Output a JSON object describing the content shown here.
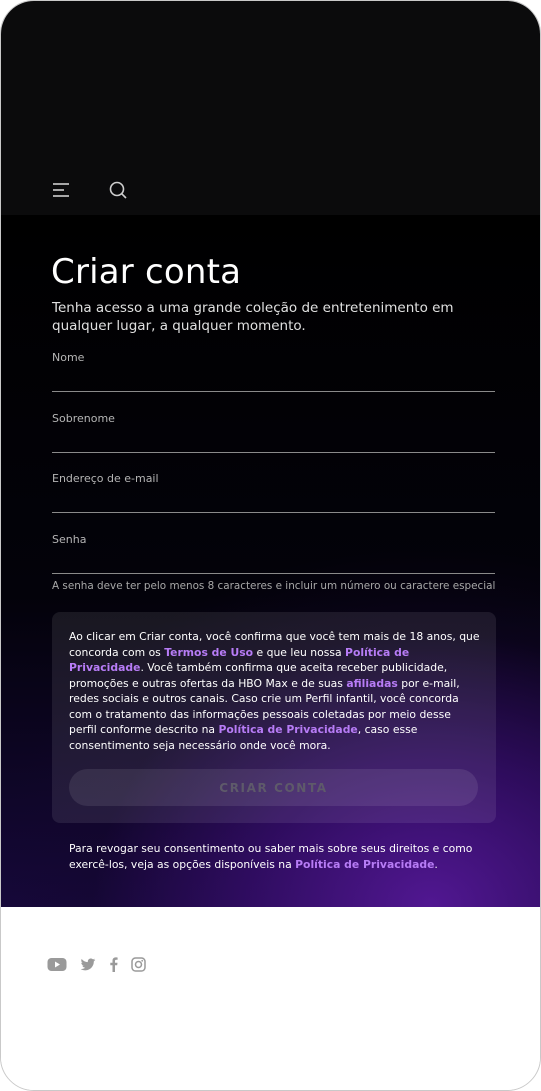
{
  "header": {
    "menu_icon": "hamburger-menu-icon",
    "search_icon": "search-icon"
  },
  "page": {
    "title": "Criar conta",
    "subtitle": "Tenha acesso a uma grande coleção de entretenimento em qualquer lugar, a qualquer momento."
  },
  "form": {
    "first_name_label": "Nome",
    "first_name_value": "",
    "last_name_label": "Sobrenome",
    "last_name_value": "",
    "email_label": "Endereço de e-mail",
    "email_value": "",
    "password_label": "Senha",
    "password_value": "",
    "password_hint": "A senha deve ter pelo menos 8 caracteres e incluir um número ou caractere especial"
  },
  "consent": {
    "text_1": "Ao clicar em Criar conta, você confirma que você tem mais de 18 anos, que concorda com os ",
    "terms_link": "Termos de Uso",
    "text_2": " e que leu nossa ",
    "privacy_link": "Política de Privacidade",
    "text_3": ". Você também confirma que aceita receber publicidade, promoções e outras ofertas da HBO Max e de suas ",
    "affiliates_link": "afiliadas",
    "text_4": " por e-mail, redes sociais e outros canais. Caso crie um Perfil infantil, você concorda com o tratamento das informações pessoais coletadas por meio desse perfil conforme descrito na ",
    "privacy_link_2": "Política de Privacidade",
    "text_5": ", caso esse consentimento seja necessário onde você mora.",
    "button_label": "CRIAR CONTA",
    "button_enabled": false
  },
  "revoke": {
    "text": "Para revogar seu consentimento ou saber mais sobre seus direitos e como exercê-los, veja as opções disponíveis na ",
    "link": "Política de Privacidade",
    "end": "."
  },
  "footer": {
    "social_icons": [
      "youtube-icon",
      "twitter-icon",
      "facebook-icon",
      "instagram-icon"
    ]
  },
  "colors": {
    "link": "#b77cf6",
    "background": "#000000",
    "gradient_purple": "#541896"
  }
}
